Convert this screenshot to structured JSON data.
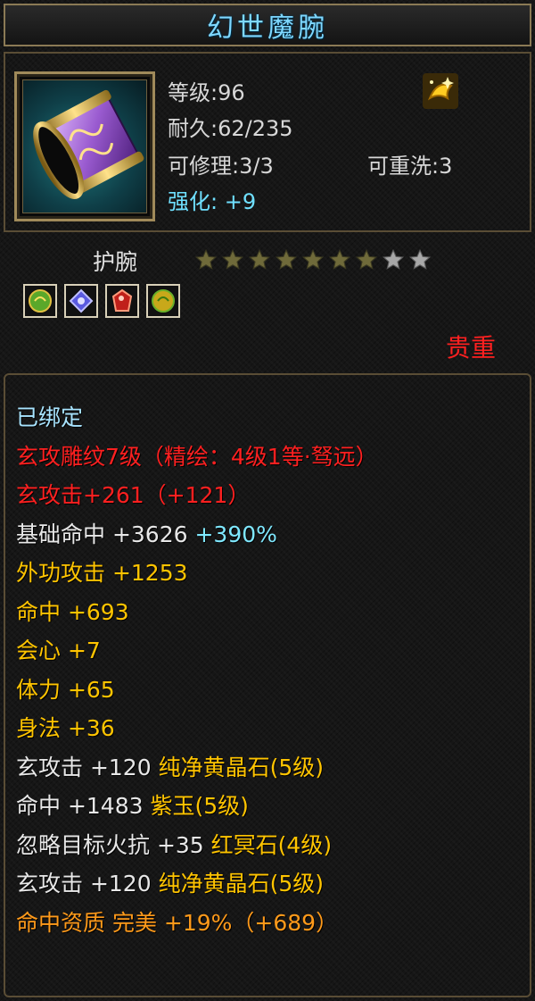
{
  "item": {
    "name": "幻世魔腕",
    "level": "等级:96",
    "durability": "耐久:62/235",
    "repair": "可修理:3/3",
    "reroll": "可重洗:3",
    "enhance": "强化: +9",
    "type": "护腕",
    "stars_total": 9,
    "stars_filled": 7,
    "rarity": "贵重"
  },
  "gem_slots": [
    "green-gem-icon",
    "blue-gem-icon",
    "red-gem-icon",
    "yellow-gem-icon"
  ],
  "stats": [
    {
      "parts": [
        {
          "text": "已绑定",
          "color": "boundblue"
        }
      ]
    },
    {
      "parts": [
        {
          "text": "玄攻雕纹7级（精绘：4级1等·驽远）",
          "color": "red"
        }
      ]
    },
    {
      "parts": [
        {
          "text": "玄攻击+261（+121）",
          "color": "red"
        }
      ]
    },
    {
      "parts": [
        {
          "text": "基础命中 +3626 ",
          "color": "white"
        },
        {
          "text": "+390%",
          "color": "cyan"
        }
      ]
    },
    {
      "parts": [
        {
          "text": "外功攻击 +1253",
          "color": "gold"
        }
      ]
    },
    {
      "parts": [
        {
          "text": "命中 +693",
          "color": "gold"
        }
      ]
    },
    {
      "parts": [
        {
          "text": "会心 +7",
          "color": "gold"
        }
      ]
    },
    {
      "parts": [
        {
          "text": "体力 +65",
          "color": "gold"
        }
      ]
    },
    {
      "parts": [
        {
          "text": "身法 +36",
          "color": "gold"
        }
      ]
    },
    {
      "parts": [
        {
          "text": "玄攻击 +120 ",
          "color": "white"
        },
        {
          "text": "纯净黄晶石(5级)",
          "color": "gold"
        }
      ]
    },
    {
      "parts": [
        {
          "text": "命中 +1483 ",
          "color": "white"
        },
        {
          "text": "紫玉(5级)",
          "color": "gold"
        }
      ]
    },
    {
      "parts": [
        {
          "text": "忽略目标火抗 +35 ",
          "color": "white"
        },
        {
          "text": "红冥石(4级)",
          "color": "gold"
        }
      ]
    },
    {
      "parts": [
        {
          "text": "玄攻击 +120 ",
          "color": "white"
        },
        {
          "text": "纯净黄晶石(5级)",
          "color": "gold"
        }
      ]
    },
    {
      "parts": [
        {
          "text": "命中资质  完美 +19%（+689）",
          "color": "orange"
        }
      ]
    }
  ],
  "colors": {
    "title": "#7fd8ff",
    "red": "#ff2020",
    "gold": "#ffc400",
    "cyan": "#7fe8ff",
    "orange": "#ff9a1a"
  }
}
